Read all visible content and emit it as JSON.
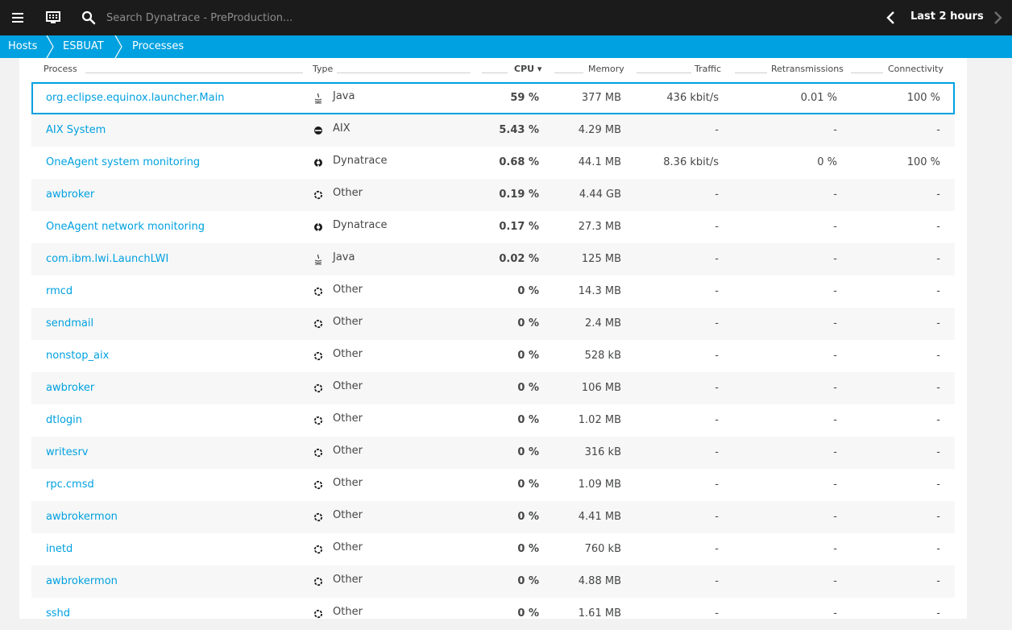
{
  "topbar": {
    "menu_icon": "hamburger-menu-icon",
    "monitor_icon": "monitor-icon",
    "search_icon": "search-icon",
    "search_placeholder": "Search Dynatrace - PreProduction...",
    "timeframe_label": "Last 2 hours"
  },
  "breadcrumb": {
    "items": [
      {
        "label": "Hosts"
      },
      {
        "label": "ESBUAT"
      },
      {
        "label": "Processes"
      }
    ]
  },
  "colors": {
    "topbar_bg": "#1b1b1b",
    "accent": "#00a1e0",
    "link": "#00a1e0",
    "page_bg": "#f2f2f2",
    "alt_row": "#f7f7f7"
  },
  "table": {
    "columns": {
      "process": "Process",
      "type": "Type",
      "cpu": "CPU ▾",
      "memory": "Memory",
      "traffic": "Traffic",
      "retransmissions": "Retransmissions",
      "connectivity": "Connectivity"
    },
    "rows": [
      {
        "process": "org.eclipse.equinox.launcher.Main",
        "type": "Java",
        "icon": "java-icon",
        "cpu": "59 %",
        "memory": "377 MB",
        "traffic": "436 kbit/s",
        "retrans": "0.01 %",
        "conn": "100 %"
      },
      {
        "process": "AIX System",
        "type": "AIX",
        "icon": "aix-icon",
        "cpu": "5.43 %",
        "memory": "4.29 MB",
        "traffic": "-",
        "retrans": "-",
        "conn": "-"
      },
      {
        "process": "OneAgent system monitoring",
        "type": "Dynatrace",
        "icon": "dynatrace-icon",
        "cpu": "0.68 %",
        "memory": "44.1 MB",
        "traffic": "8.36 kbit/s",
        "retrans": "0 %",
        "conn": "100 %"
      },
      {
        "process": "awbroker",
        "type": "Other",
        "icon": "other-process-icon",
        "cpu": "0.19 %",
        "memory": "4.44 GB",
        "traffic": "-",
        "retrans": "-",
        "conn": "-"
      },
      {
        "process": "OneAgent network monitoring",
        "type": "Dynatrace",
        "icon": "dynatrace-icon",
        "cpu": "0.17 %",
        "memory": "27.3 MB",
        "traffic": "-",
        "retrans": "-",
        "conn": "-"
      },
      {
        "process": "com.ibm.lwi.LaunchLWI",
        "type": "Java",
        "icon": "java-icon",
        "cpu": "0.02 %",
        "memory": "125 MB",
        "traffic": "-",
        "retrans": "-",
        "conn": "-"
      },
      {
        "process": "rmcd",
        "type": "Other",
        "icon": "other-process-icon",
        "cpu": "0 %",
        "memory": "14.3 MB",
        "traffic": "-",
        "retrans": "-",
        "conn": "-"
      },
      {
        "process": "sendmail",
        "type": "Other",
        "icon": "other-process-icon",
        "cpu": "0 %",
        "memory": "2.4 MB",
        "traffic": "-",
        "retrans": "-",
        "conn": "-"
      },
      {
        "process": "nonstop_aix",
        "type": "Other",
        "icon": "other-process-icon",
        "cpu": "0 %",
        "memory": "528 kB",
        "traffic": "-",
        "retrans": "-",
        "conn": "-"
      },
      {
        "process": "awbroker",
        "type": "Other",
        "icon": "other-process-icon",
        "cpu": "0 %",
        "memory": "106 MB",
        "traffic": "-",
        "retrans": "-",
        "conn": "-"
      },
      {
        "process": "dtlogin",
        "type": "Other",
        "icon": "other-process-icon",
        "cpu": "0 %",
        "memory": "1.02 MB",
        "traffic": "-",
        "retrans": "-",
        "conn": "-"
      },
      {
        "process": "writesrv",
        "type": "Other",
        "icon": "other-process-icon",
        "cpu": "0 %",
        "memory": "316 kB",
        "traffic": "-",
        "retrans": "-",
        "conn": "-"
      },
      {
        "process": "rpc.cmsd",
        "type": "Other",
        "icon": "other-process-icon",
        "cpu": "0 %",
        "memory": "1.09 MB",
        "traffic": "-",
        "retrans": "-",
        "conn": "-"
      },
      {
        "process": "awbrokermon",
        "type": "Other",
        "icon": "other-process-icon",
        "cpu": "0 %",
        "memory": "4.41 MB",
        "traffic": "-",
        "retrans": "-",
        "conn": "-"
      },
      {
        "process": "inetd",
        "type": "Other",
        "icon": "other-process-icon",
        "cpu": "0 %",
        "memory": "760 kB",
        "traffic": "-",
        "retrans": "-",
        "conn": "-"
      },
      {
        "process": "awbrokermon",
        "type": "Other",
        "icon": "other-process-icon",
        "cpu": "0 %",
        "memory": "4.88 MB",
        "traffic": "-",
        "retrans": "-",
        "conn": "-"
      },
      {
        "process": "sshd",
        "type": "Other",
        "icon": "other-process-icon",
        "cpu": "0 %",
        "memory": "1.61 MB",
        "traffic": "-",
        "retrans": "-",
        "conn": "-"
      }
    ]
  }
}
